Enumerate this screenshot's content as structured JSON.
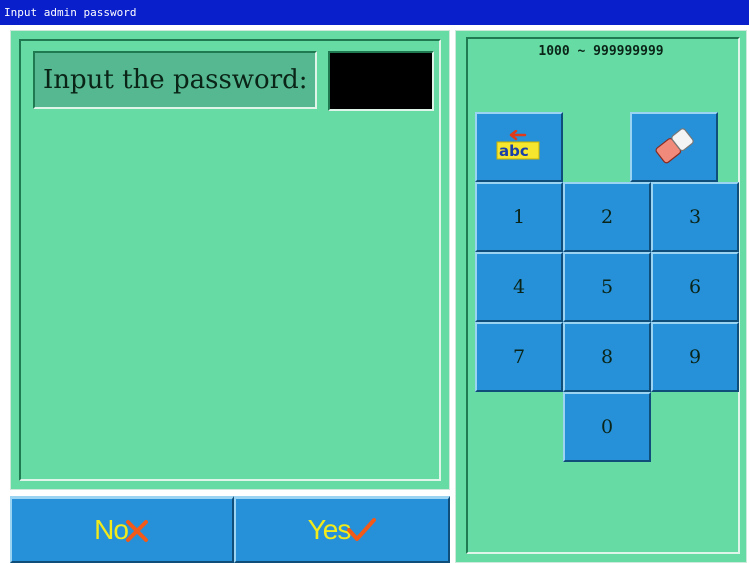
{
  "window": {
    "title": "Input admin password"
  },
  "prompt": {
    "label": "Input the password:",
    "value": ""
  },
  "range_hint": "1000 ~ 999999999",
  "keypad": {
    "backspace_icon": "abc-backspace-icon",
    "clear_icon": "eraser-icon",
    "keys": [
      "1",
      "2",
      "3",
      "4",
      "5",
      "6",
      "7",
      "8",
      "9",
      "0"
    ]
  },
  "buttons": {
    "no": "No",
    "yes": "Yes"
  },
  "colors": {
    "panel_bg": "#66dba4",
    "button_bg": "#2691d8",
    "title_bg": "#0a1fcc",
    "button_text": "#f2ea1a"
  }
}
